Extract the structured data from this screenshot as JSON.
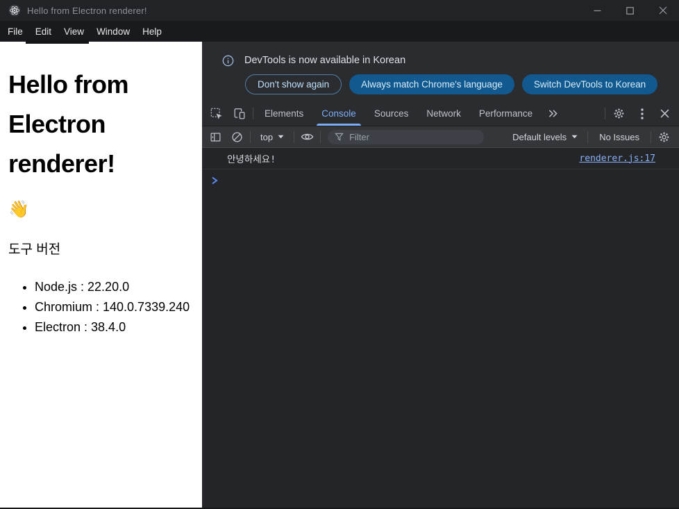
{
  "window": {
    "title": "Hello from Electron renderer!"
  },
  "menubar": {
    "items": [
      "File",
      "Edit",
      "View",
      "Window",
      "Help"
    ]
  },
  "page": {
    "heading": "Hello from Electron renderer!",
    "wave_emoji": "👋",
    "tools_heading": "도구 버전",
    "versions": [
      "Node.js : 22.20.0",
      "Chromium : 140.0.7339.240",
      "Electron : 38.4.0"
    ]
  },
  "devtools": {
    "banner": {
      "message": "DevTools is now available in Korean",
      "buttons": [
        "Don't show again",
        "Always match Chrome's language",
        "Switch DevTools to Korean"
      ]
    },
    "tabs": [
      "Elements",
      "Console",
      "Sources",
      "Network",
      "Performance"
    ],
    "active_tab": "Console",
    "console_toolbar": {
      "context": "top",
      "filter_placeholder": "Filter",
      "levels_label": "Default levels",
      "issues_label": "No Issues"
    },
    "console": {
      "message": "안녕하세요!",
      "source_link": "renderer.js:17"
    }
  },
  "colors": {
    "accent_tab": "#7cacf8",
    "banner_button_fill": "#11598e",
    "link": "#8ab0f8",
    "prompt": "#5f8af5"
  }
}
